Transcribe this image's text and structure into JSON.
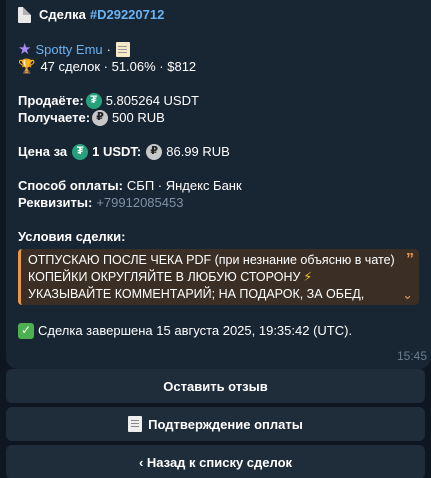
{
  "deal": {
    "title_prefix": "Сделка",
    "deal_id": "#D29220712",
    "seller_name": "Spotty Emu",
    "separator": "·",
    "stats": "47 сделок · 51.06% · $812",
    "sell_label": "Продаёте:",
    "sell_value": "5.805264 USDT",
    "receive_label": "Получаете:",
    "receive_value": "500 RUB",
    "price_label": "Цена за",
    "price_unit": "1 USDT:",
    "price_value": "86.99 RUB",
    "payment_label": "Способ оплаты:",
    "payment_value": "СБП · Яндекс Банк",
    "requisites_label": "Реквизиты:",
    "requisites_value": "+79912085453",
    "conditions_label": "Условия сделки:",
    "conditions_lines": [
      "ОТПУСКАЮ ПОСЛЕ ЧЕКА PDF (при незнание объясню в чате)",
      "КОПЕЙКИ ОКРУГЛЯЙТЕ В ЛЮБУЮ СТОРОНУ",
      "УКАЗЫВАЙТЕ КОММЕНТАРИЙ; НА ПОДАРОК, ЗА ОБЕД,"
    ],
    "completed_text": "Сделка завершена 15 августа 2025, 19:35:42 (UTC).",
    "time": "15:45"
  },
  "buttons": {
    "feedback": "Оставить отзыв",
    "payment_confirm": "Подтверждение оплаты",
    "back": "‹ Назад к списку сделок"
  },
  "icons": {
    "title": "document-icon",
    "seller": "star-icon",
    "note": "memo-icon",
    "stats": "trophy-icon",
    "usdt": "tether-icon",
    "rub": "ruble-icon",
    "completed": "check-mark-icon",
    "receipt": "receipt-icon"
  },
  "colors": {
    "background": "#0e1621",
    "bubble": "#182533",
    "link": "#6ab3f3",
    "quote_accent": "#e8984c",
    "tether": "#26a17b",
    "check": "#4caf50"
  }
}
